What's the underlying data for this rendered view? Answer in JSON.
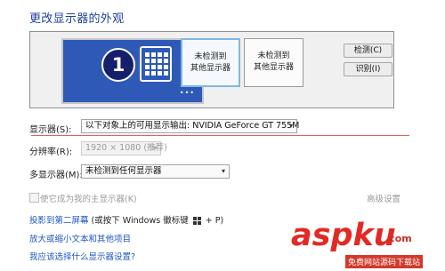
{
  "page": {
    "title": "更改显示器的外观"
  },
  "preview": {
    "monitor1_number": "1",
    "monitor1_dots": "•••",
    "monitor2_label": "未检测到\n其他显示器",
    "monitor3_label": "未检测到\n其他显示器",
    "detect_button": "检测(C)",
    "identify_button": "识别(I)"
  },
  "settings": {
    "display_label": "显示器(S):",
    "display_value": "以下对象上的可用显示输出: NVIDIA GeForce GT 755M",
    "resolution_label": "分辨率(R):",
    "resolution_value": "1920 × 1080 (推荐)",
    "multi_label": "多显示器(M):",
    "multi_value": "未检测到任何显示器",
    "main_checkbox_label": "使它成为我的主显示器(K)",
    "advanced_link": "高级设置"
  },
  "links": {
    "project_text": "投影到第二屏幕",
    "project_hint_before": "(或按下 Windows 徽标键",
    "project_hint_after": "+ P)",
    "text_size": "放大或缩小文本和其他项目",
    "which_settings": "我应该选择什么显示器设置?"
  },
  "watermark": {
    "brand": "aspku",
    "domain": ".com",
    "tagline": "免费网站源码下载站"
  },
  "colors": {
    "title": "#1e3f9e",
    "monitor1_bg": "#2e59b6",
    "link": "#1f56c2",
    "accent_line": "#e06060",
    "watermark": "#e32925"
  }
}
